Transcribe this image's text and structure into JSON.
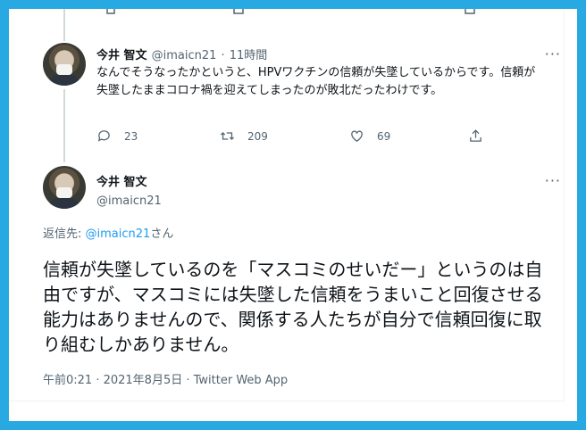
{
  "tweet1": {
    "display_name": "今井 智文",
    "handle": "@imaicn21",
    "separator": "·",
    "time": "11時間",
    "text": "なんでそうなったかというと、HPVワクチンの信頼が失墜しているからです。信頼が失墜したままコロナ禍を迎えてしまったのが敗北だったわけです。",
    "replies": "23",
    "retweets": "209",
    "likes": "69",
    "more": "···"
  },
  "tweet2": {
    "display_name": "今井 智文",
    "handle": "@imaicn21",
    "more": "···",
    "reply_prefix": "返信先: ",
    "reply_handle": "@imaicn21",
    "reply_suffix": "さん",
    "text": "信頼が失墜しているのを「マスコミのせいだー」というのは自由ですが、マスコミには失墜した信頼をうまいこと回復させる能力はありませんので、関係する人たちが自分で信頼回復に取り組むしかありません。",
    "timestamp": "午前0:21 · 2021年8月5日 · Twitter Web App"
  },
  "colors": {
    "background": "#29a9e1",
    "link": "#1d9bf0",
    "secondary_text": "#536471",
    "primary_text": "#0f1419"
  }
}
